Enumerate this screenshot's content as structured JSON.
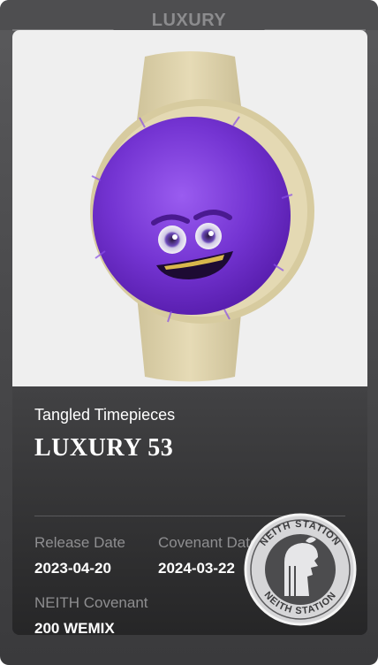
{
  "card": {
    "tab_label": "LUXURY",
    "collection": "Tangled Timepieces",
    "title": "LUXURY 53",
    "release_date_label": "Release Date",
    "release_date": "2023-04-20",
    "covenant_date_label": "Covenant Date",
    "covenant_date": "2024-03-22",
    "covenant_label": "NEITH Covenant",
    "covenant_price": "200 WEMIX",
    "seal_text": "NEITH STATION"
  },
  "colors": {
    "accent_purple": "#7b3fd6",
    "strap_cream": "#e2d6b0",
    "panel_dark": "#2a2a2b"
  },
  "icons": [
    "purple-monster-watch-image",
    "neith-station-seal-icon"
  ]
}
